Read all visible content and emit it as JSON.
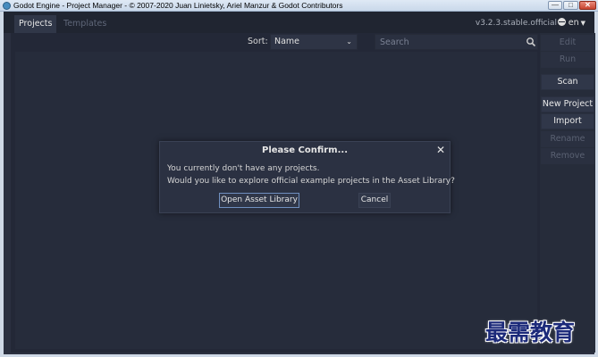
{
  "window": {
    "title": "Godot Engine - Project Manager - © 2007-2020 Juan Linietsky, Ariel Manzur & Godot Contributors",
    "controls": {
      "minimize": "—",
      "maximize": "□",
      "close": "✕"
    }
  },
  "tabs": [
    {
      "label": "Projects",
      "active": true
    },
    {
      "label": "Templates",
      "active": false
    }
  ],
  "version": "v3.2.3.stable.official",
  "language": {
    "code": "en",
    "icon": "globe-icon"
  },
  "toolbar": {
    "sort_label": "Sort:",
    "sort_value": "Name",
    "search_placeholder": "Search"
  },
  "sidebar": {
    "buttons": [
      {
        "label": "Edit",
        "enabled": false
      },
      {
        "label": "Run",
        "enabled": false
      },
      {
        "label": "Scan",
        "enabled": true
      },
      {
        "label": "New Project",
        "enabled": true
      },
      {
        "label": "Import",
        "enabled": true
      },
      {
        "label": "Rename",
        "enabled": false
      },
      {
        "label": "Remove",
        "enabled": false
      }
    ]
  },
  "dialog": {
    "title": "Please Confirm...",
    "close": "✕",
    "line1": "You currently don't have any projects.",
    "line2": "Would you like to explore official example projects in the Asset Library?",
    "confirm_label": "Open Asset Library",
    "cancel_label": "Cancel"
  },
  "watermark": "最需教育",
  "colors": {
    "background": "#232837",
    "panel": "#262c3b",
    "accent": "#478cbf",
    "disabled_text": "#5a6172"
  }
}
